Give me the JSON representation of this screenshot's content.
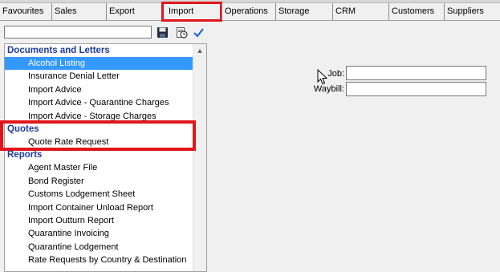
{
  "tabs": [
    {
      "label": "Favourites"
    },
    {
      "label": "Sales"
    },
    {
      "label": "Export"
    },
    {
      "label": "Import"
    },
    {
      "label": "Operations"
    },
    {
      "label": "Storage"
    },
    {
      "label": "CRM"
    },
    {
      "label": "Customers"
    },
    {
      "label": "Suppliers"
    }
  ],
  "search": {
    "value": ""
  },
  "toolbar": {
    "icons": [
      "save-icon",
      "history-icon",
      "checkmark-icon"
    ]
  },
  "groups": [
    {
      "title": "Documents and Letters",
      "items": [
        {
          "label": "Alcohol Listing",
          "selected": true
        },
        {
          "label": "Insurance Denial Letter"
        },
        {
          "label": "Import Advice"
        },
        {
          "label": "Import Advice - Quarantine Charges"
        },
        {
          "label": "Import Advice - Storage Charges"
        }
      ]
    },
    {
      "title": "Quotes",
      "items": [
        {
          "label": "Quote Rate Request"
        }
      ]
    },
    {
      "title": "Reports",
      "items": [
        {
          "label": "Agent Master File"
        },
        {
          "label": "Bond Register"
        },
        {
          "label": "Customs Lodgement Sheet"
        },
        {
          "label": "Import Container Unload Report"
        },
        {
          "label": "Import Outturn Report"
        },
        {
          "label": "Quarantine Invoicing"
        },
        {
          "label": "Quarantine Lodgement"
        },
        {
          "label": "Rate Requests by Country & Destination"
        }
      ]
    }
  ],
  "form": {
    "job_label": "Job:",
    "job_value": "",
    "waybill_label": "Waybill:",
    "waybill_value": ""
  },
  "colors": {
    "highlight": "#e0161b",
    "group_title": "#1d3ba0",
    "selection": "#3399ff"
  }
}
